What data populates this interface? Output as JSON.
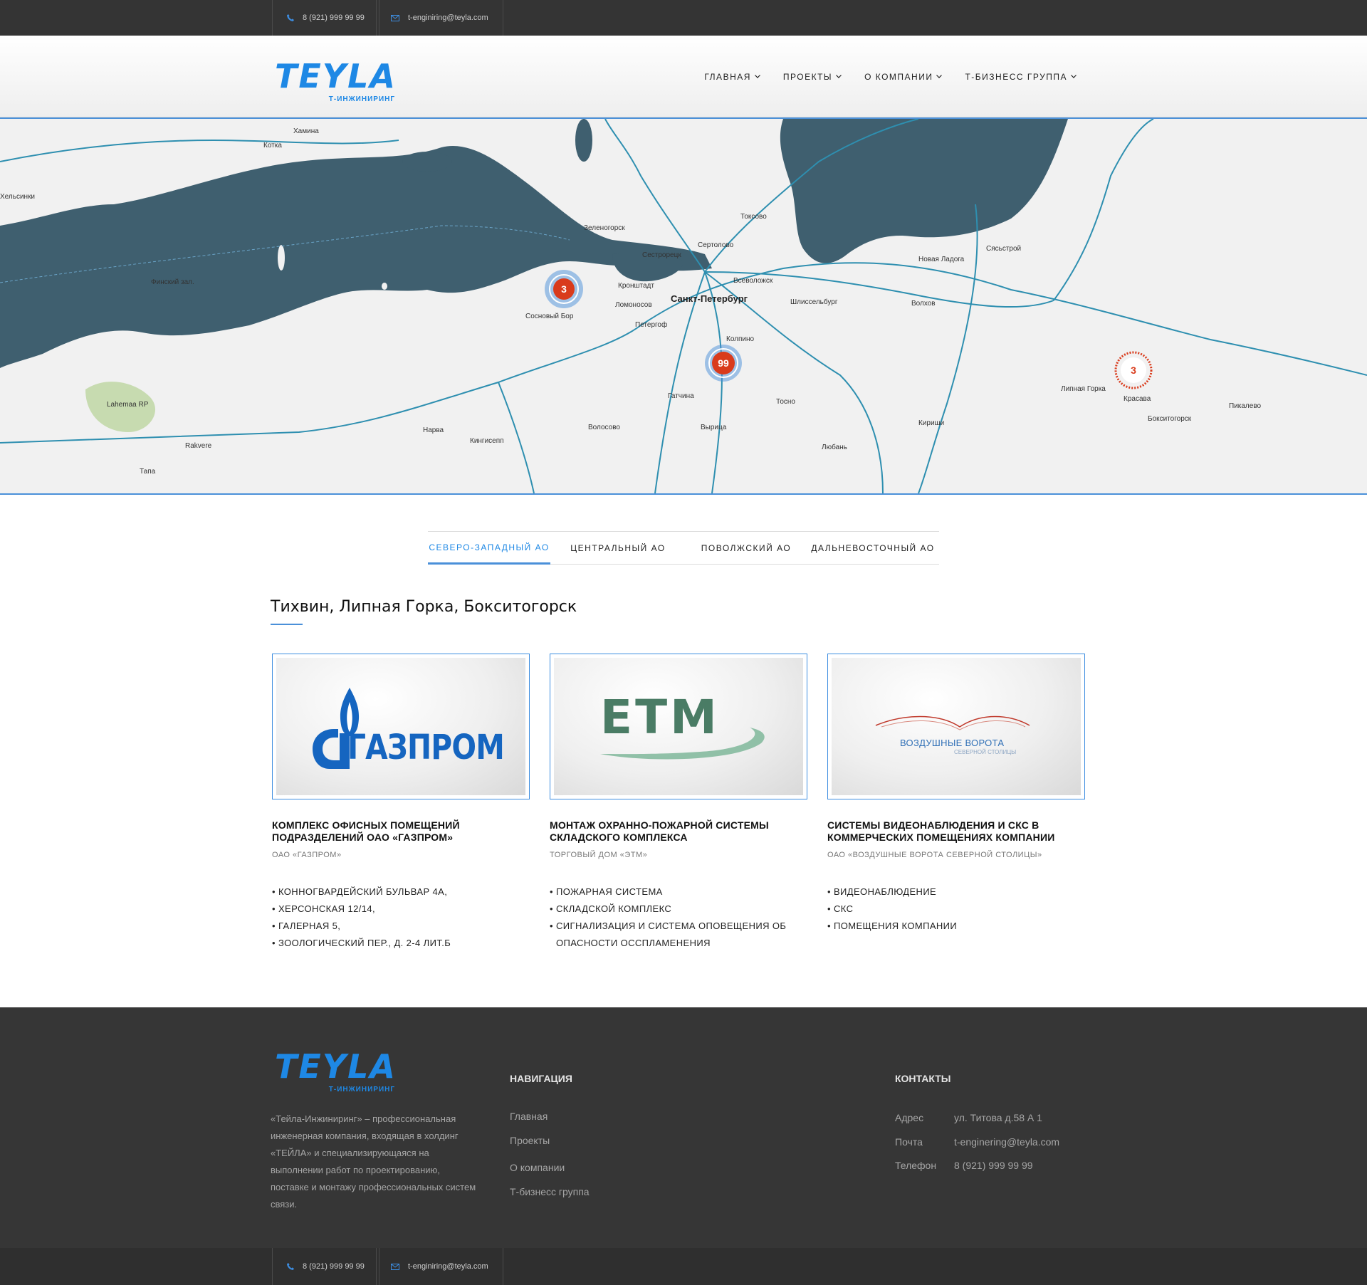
{
  "topbar": {
    "phone": "8 (921) 999 99 99",
    "email": "t-enginiring@teyla.com"
  },
  "brand": {
    "name": "TEYLA",
    "tagline": "Т-ИНЖИНИРИНГ",
    "color": "#1e88e5"
  },
  "nav": {
    "items": [
      {
        "label": "Главная"
      },
      {
        "label": "Проекты"
      },
      {
        "label": "О компании"
      },
      {
        "label": "Т-Бизнесс группа"
      }
    ]
  },
  "map": {
    "markers": [
      {
        "count": "3",
        "color": "#d93b1c"
      },
      {
        "count": "99",
        "color": "#d93b1c"
      },
      {
        "count": "3",
        "color": "#d93b1c"
      }
    ],
    "labels": {
      "spb": "Санкт-Петербург",
      "kronshtadt": "Кронштадт",
      "sosnovy_bor": "Сосновый Бор",
      "lomonosov": "Ломоносов",
      "peterhof": "Петергоф",
      "kolpino": "Колпино",
      "gatchina": "Гатчина",
      "tosno": "Тосно",
      "vsevolozhsk": "Всеволожск",
      "shlisselburg": "Шлиссельбург",
      "sestroretsk": "Сестрорецк",
      "volkhov": "Волхов",
      "kirishi": "Кириши",
      "narva": "Нарва",
      "kingisepp": "Кингисепп",
      "kotka": "Котка",
      "hamina": "Хамина",
      "helsinki": "Хельсинки",
      "tikhvin_area": "Липная Горка",
      "krasava": "Красава",
      "boksitogorsk": "Бокситогорск",
      "pikalevo": "Пикалево",
      "novaya_ladoga": "Новая Ладога",
      "sясьstroy": "Сясьстрой",
      "finsky_zaliv": "Финский зал.",
      "zelenogorsk": "Зеленогорск",
      "sertolovo": "Сертолово",
      "toksovo": "Токсово",
      "vyritsa": "Вырица",
      "luban": "Любань",
      "volosovo": "Волосово",
      "rakvere": "Rakvere",
      "tapa": "Тапа",
      "lahemaa": "Lahemaa RP"
    }
  },
  "tabs": [
    {
      "label": "Северо-Западный АО",
      "active": true
    },
    {
      "label": "Центральный АО",
      "active": false
    },
    {
      "label": "Поволжский АО",
      "active": false
    },
    {
      "label": "Дальневосточный АО",
      "active": false
    }
  ],
  "region": {
    "title": "Тихвин, Липная Горка, Бокситогорск"
  },
  "projects": [
    {
      "logo_text": "ГАЗПРОМ",
      "title": "Комплекс офисных помещений подразделений ОАО «Газпром»",
      "client": "ОАО «Газпром»",
      "items": [
        "Конногвардейский бульвар 4А,",
        "Херсонская 12/14,",
        "Галерная 5,",
        "Зоологический пер., д. 2-4 лит.Б"
      ]
    },
    {
      "logo_text": "ETM",
      "title": "Монтаж охранно-пожарной системы складского комплекса",
      "client": "Торговый дом «ЭТМ»",
      "items": [
        "Пожарная система",
        "Складской комплекс",
        "Сигнализация и система оповещения об опасности осспламенения"
      ]
    },
    {
      "logo_text": "ВОЗДУШНЫЕ ВОРОТА",
      "logo_sub": "СЕВЕРНОЙ СТОЛИЦЫ",
      "title": "Системы видеонаблюдения и СКС в коммерческих помещениях компании",
      "client": "ОАО «Воздушные ворота северной столицы»",
      "items": [
        "Видеонаблюдение",
        "СКС",
        "Помещения компании"
      ]
    }
  ],
  "footer": {
    "about": "«Тейла-Инжиниринг» – профессиональная инженерная компания, входящая в холдинг «ТЕЙЛА» и специализирующаяся на выполнении работ по проектированию, поставке и монтажу профессиональных систем связи.",
    "nav_heading": "Навигация",
    "nav_items": [
      "Главная",
      "Проекты",
      "О компании",
      "Т-бизнесс группа"
    ],
    "contacts_heading": "Контакты",
    "contacts": [
      {
        "label": "Адрес",
        "value": "ул. Титова д.58 А 1"
      },
      {
        "label": "Почта",
        "value": "t-enginering@teyla.com"
      },
      {
        "label": "Телефон",
        "value": "8 (921) 999 99 99"
      }
    ]
  }
}
